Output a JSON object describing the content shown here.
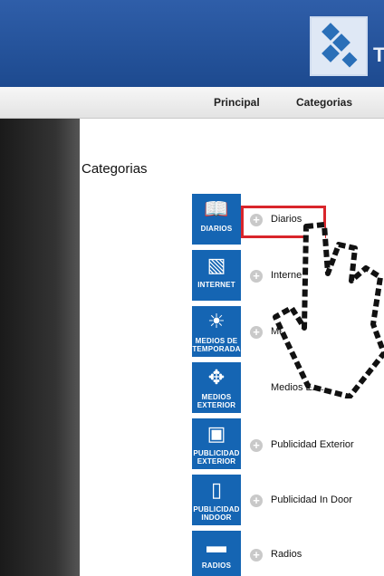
{
  "header": {
    "logo_letter": "T",
    "accent": "#1d4a8f"
  },
  "nav": {
    "items": [
      "Principal",
      "Categorias"
    ]
  },
  "page": {
    "title": "Categorias"
  },
  "categories": [
    {
      "badge": "DIARIOS",
      "icon": "book-icon",
      "name": "Diarios"
    },
    {
      "badge": "INTERNET",
      "icon": "browser-icon",
      "name": "Interne"
    },
    {
      "badge": "MEDIOS DE TEMPORADA",
      "icon": "sun-icon",
      "name": "Med"
    },
    {
      "badge": "MEDIOS EXTERIOR",
      "icon": "cross-arrows-icon",
      "name": "Medios Exterior"
    },
    {
      "badge": "PUBLICIDAD EXTERIOR",
      "icon": "billboard-icon",
      "name": "Publicidad Exterior"
    },
    {
      "badge": "PUBLICIDAD INDOOR",
      "icon": "door-icon",
      "name": "Publicidad In Door"
    },
    {
      "badge": "RADIOS",
      "icon": "radio-icon",
      "name": "Radios"
    }
  ],
  "highlight_color": "#d9252b"
}
